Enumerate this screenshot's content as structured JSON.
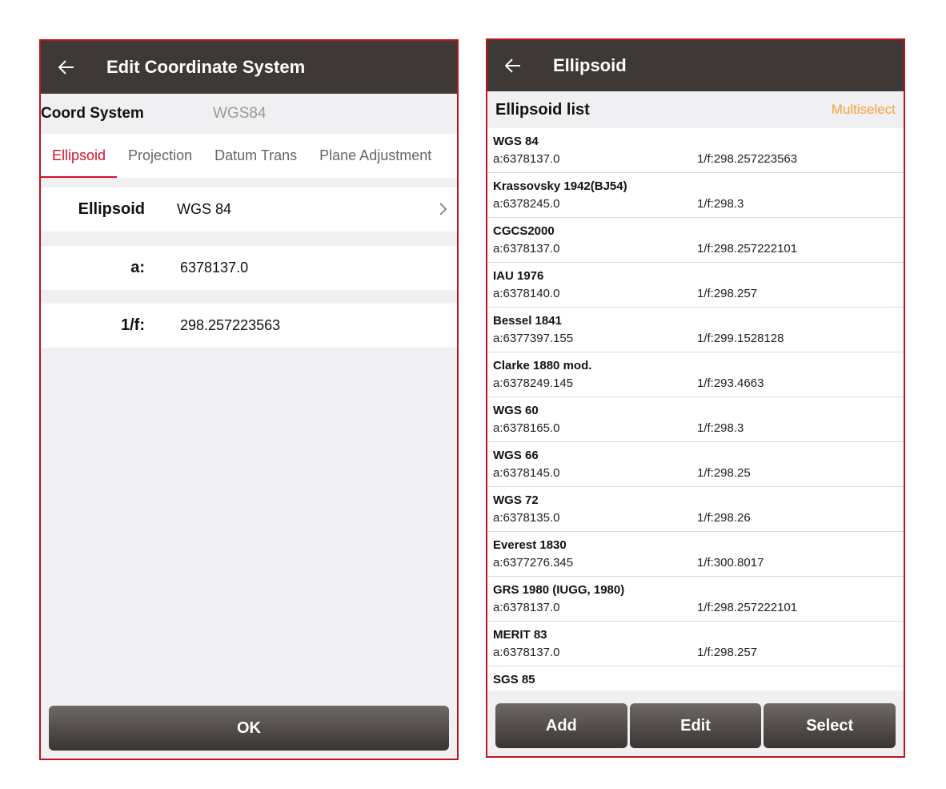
{
  "left": {
    "title": "Edit Coordinate System",
    "coord_label": "Coord System",
    "coord_value": "WGS84",
    "tabs": [
      {
        "label": "Ellipsoid"
      },
      {
        "label": "Projection"
      },
      {
        "label": "Datum Trans"
      },
      {
        "label": "Plane Adjustment"
      }
    ],
    "fields": {
      "ellipsoid_label": "Ellipsoid",
      "ellipsoid_value": "WGS 84",
      "a_label": "a:",
      "a_value": "6378137.0",
      "f_label": "1/f:",
      "f_value": "298.257223563"
    },
    "ok_label": "OK"
  },
  "right": {
    "title": "Ellipsoid",
    "list_title": "Ellipsoid list",
    "multiselect": "Multiselect",
    "items": [
      {
        "name": "WGS 84",
        "a": "a:6378137.0",
        "f": "1/f:298.257223563"
      },
      {
        "name": "Krassovsky 1942(BJ54)",
        "a": "a:6378245.0",
        "f": "1/f:298.3"
      },
      {
        "name": "CGCS2000",
        "a": "a:6378137.0",
        "f": "1/f:298.257222101"
      },
      {
        "name": "IAU 1976",
        "a": "a:6378140.0",
        "f": "1/f:298.257"
      },
      {
        "name": "Bessel 1841",
        "a": "a:6377397.155",
        "f": "1/f:299.1528128"
      },
      {
        "name": "Clarke 1880 mod.",
        "a": "a:6378249.145",
        "f": "1/f:293.4663"
      },
      {
        "name": "WGS 60",
        "a": "a:6378165.0",
        "f": "1/f:298.3"
      },
      {
        "name": "WGS 66",
        "a": "a:6378145.0",
        "f": "1/f:298.25"
      },
      {
        "name": "WGS 72",
        "a": "a:6378135.0",
        "f": "1/f:298.26"
      },
      {
        "name": "Everest 1830",
        "a": "a:6377276.345",
        "f": "1/f:300.8017"
      },
      {
        "name": "GRS 1980 (IUGG, 1980)",
        "a": "a:6378137.0",
        "f": "1/f:298.257222101"
      },
      {
        "name": "MERIT 83",
        "a": "a:6378137.0",
        "f": "1/f:298.257"
      },
      {
        "name": "SGS 85",
        "a": "",
        "f": ""
      }
    ],
    "buttons": {
      "add": "Add",
      "edit": "Edit",
      "select": "Select"
    }
  },
  "colors": {
    "appbar": "#3e3836",
    "accent_red": "#d5102a",
    "multiselect_orange": "#f3a23a",
    "frame_border": "#c0141e"
  },
  "icons": {
    "back": "arrow-left-icon",
    "chevron": "chevron-right-icon"
  }
}
